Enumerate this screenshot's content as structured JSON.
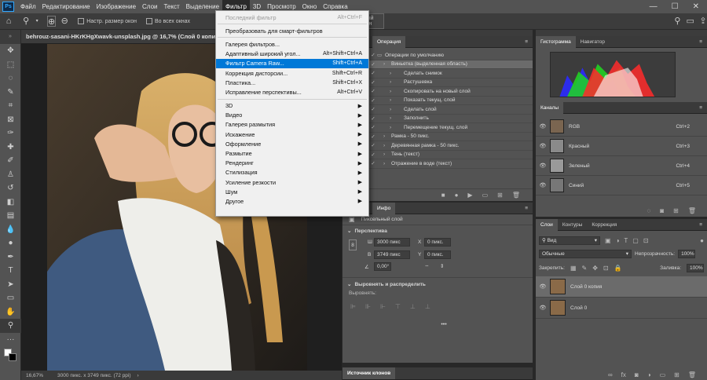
{
  "menubar": {
    "logo": "Ps",
    "items": [
      "Файл",
      "Редактирование",
      "Изображение",
      "Слои",
      "Текст",
      "Выделение",
      "Фильтр",
      "3D",
      "Просмотр",
      "Окно",
      "Справка"
    ],
    "active_index": 6
  },
  "options_bar": {
    "resize_windows_label": "Настр. размер окон",
    "all_windows_label": "Во всех окнах",
    "fullscreen_button": "льный экран"
  },
  "document": {
    "tab_title": "behrouz-sasani-HKrKHgXwavk-unsplash.jpg @ 16,7% (Слой 0 копия, RGB/8) *",
    "zoom": "16,67%",
    "info": "3000 пикс. x 3749 пикс. (72 ppi)"
  },
  "filter_menu": {
    "items": [
      {
        "label": "Последний фильтр",
        "shortcut": "Alt+Ctrl+F",
        "disabled": true
      },
      {
        "sep": true
      },
      {
        "label": "Преобразовать для смарт-фильтров"
      },
      {
        "sep": true
      },
      {
        "label": "Галерея фильтров..."
      },
      {
        "label": "Адаптивный широкий угол...",
        "shortcut": "Alt+Shift+Ctrl+A"
      },
      {
        "label": "Фильтр Camera Raw...",
        "shortcut": "Shift+Ctrl+A",
        "highlight": true
      },
      {
        "label": "Коррекция дисторсии...",
        "shortcut": "Shift+Ctrl+R"
      },
      {
        "label": "Пластика...",
        "shortcut": "Shift+Ctrl+X"
      },
      {
        "label": "Исправление перспективы...",
        "shortcut": "Alt+Ctrl+V"
      },
      {
        "sep": true
      },
      {
        "label": "3D",
        "submenu": true
      },
      {
        "label": "Видео",
        "submenu": true
      },
      {
        "label": "Галерея размытия",
        "submenu": true
      },
      {
        "label": "Искажение",
        "submenu": true
      },
      {
        "label": "Оформление",
        "submenu": true
      },
      {
        "label": "Размытие",
        "submenu": true
      },
      {
        "label": "Рендеринг",
        "submenu": true
      },
      {
        "label": "Стилизация",
        "submenu": true
      },
      {
        "label": "Усиление резкости",
        "submenu": true
      },
      {
        "label": "Шум",
        "submenu": true
      },
      {
        "label": "Другое",
        "submenu": true
      }
    ]
  },
  "actions_panel": {
    "tab": "Операция",
    "rows": [
      {
        "text": "Операции по умолчанию",
        "level": 0,
        "folder": true
      },
      {
        "text": "Виньетка (выделенная область)",
        "level": 1,
        "selected": true
      },
      {
        "text": "Сделать снимок",
        "level": 2
      },
      {
        "text": "Растушевка",
        "level": 2
      },
      {
        "text": "Скопировать на новый слой",
        "level": 2
      },
      {
        "text": "Показать текущ. слой",
        "level": 2
      },
      {
        "text": "Сделать слой",
        "level": 2
      },
      {
        "text": "Заполнить",
        "level": 2
      },
      {
        "text": "Перемещение текущ. слой",
        "level": 2
      },
      {
        "text": "Рамка - 50 пикс.",
        "level": 1
      },
      {
        "text": "Деревянная рамка - 50 пикс.",
        "level": 1
      },
      {
        "text": "Тень (текст)",
        "level": 1
      },
      {
        "text": "Отражение в воде (текст)",
        "level": 1
      }
    ]
  },
  "info_panel": {
    "tab": "Инфо",
    "layer_type": "Пиксельный слой",
    "section_perspective": "Перспектива",
    "w_label": "Ш",
    "w_value": "3000 пикс",
    "x_label": "X",
    "x_value": "0 пикс.",
    "h_label": "В",
    "h_value": "3749 пикс",
    "y_label": "Y",
    "y_value": "0 пикс.",
    "angle_value": "0,00°",
    "section_align": "Выровнять и распределить",
    "align_label": "Выровнять:",
    "more": "•••",
    "clone_source_tab": "Источник клонов"
  },
  "histogram_panel": {
    "tabs": [
      "Гистограмма",
      "Навигатор"
    ]
  },
  "channels_panel": {
    "tab": "Каналы",
    "rows": [
      {
        "name": "RGB",
        "shortcut": "Ctrl+2"
      },
      {
        "name": "Красный",
        "shortcut": "Ctrl+3"
      },
      {
        "name": "Зеленый",
        "shortcut": "Ctrl+4"
      },
      {
        "name": "Синий",
        "shortcut": "Ctrl+5"
      }
    ]
  },
  "layers_panel": {
    "tabs": [
      "Слои",
      "Контуры",
      "Коррекция"
    ],
    "search_kind": "Вид",
    "blend_mode": "Обычные",
    "opacity_label": "Непрозрачность:",
    "opacity_value": "100%",
    "lock_label": "Закрепить:",
    "fill_label": "Заливка:",
    "fill_value": "100%",
    "layers": [
      {
        "name": "Слой 0 копия",
        "selected": true
      },
      {
        "name": "Слой 0",
        "selected": false
      }
    ]
  },
  "colors": {
    "accent": "#0078d7",
    "panel": "#535353",
    "menubar": "#535353"
  }
}
